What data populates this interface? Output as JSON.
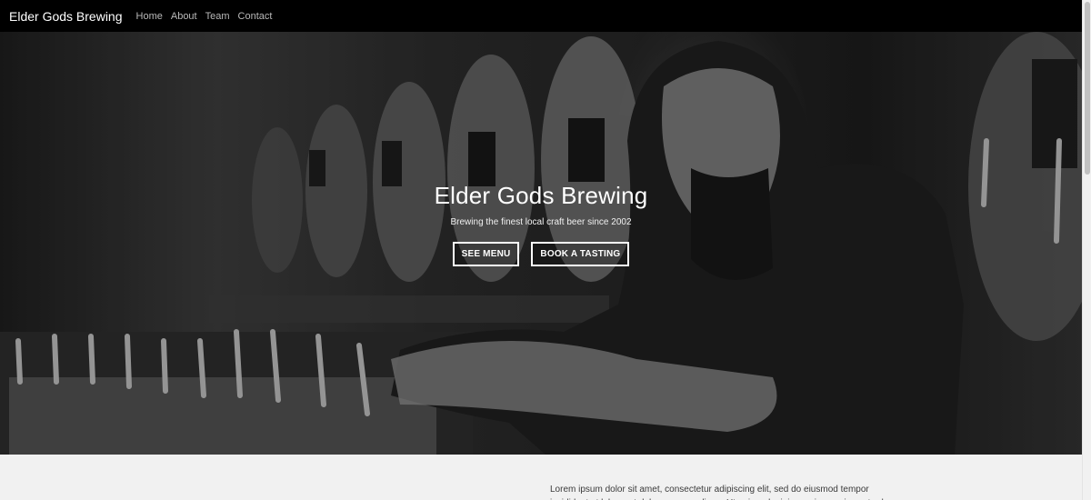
{
  "nav": {
    "brand": "Elder Gods Brewing",
    "links": [
      "Home",
      "About",
      "Team",
      "Contact"
    ]
  },
  "hero": {
    "title": "Elder Gods Brewing",
    "subtitle": "Brewing the finest local craft beer since 2002",
    "buttons": [
      "SEE MENU",
      "BOOK A TASTING"
    ]
  },
  "content": {
    "paragraph": "Lorem ipsum dolor sit amet, consectetur adipiscing elit, sed do eiusmod tempor incididunt ut labore et dolore magna aliqua. Ut enim ad minim veniam, quis nostrud"
  }
}
